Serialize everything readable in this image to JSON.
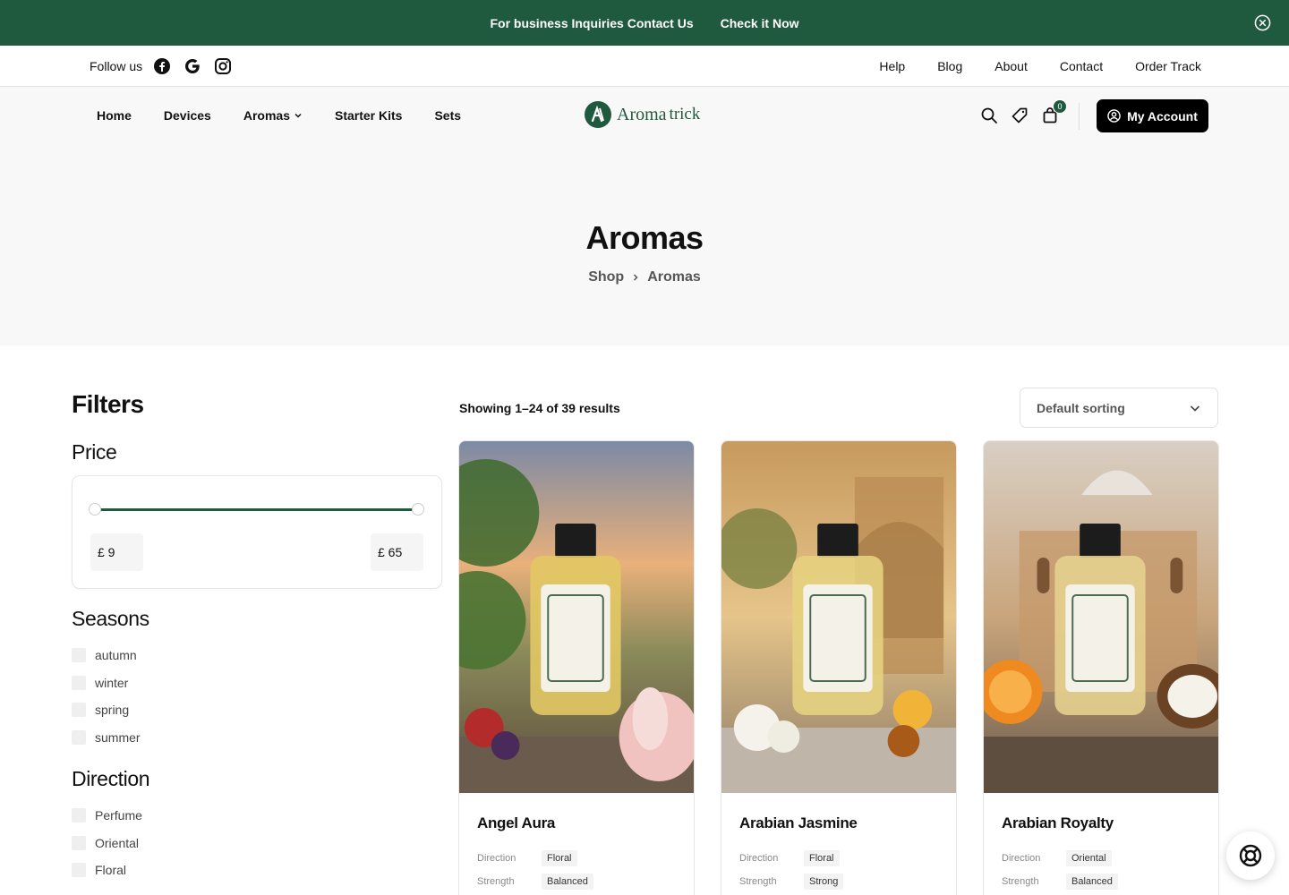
{
  "announcement": {
    "contact_link": "For business Inquiries Contact Us",
    "check_link": "Check it Now"
  },
  "utility_bar": {
    "follow_label": "Follow us",
    "social_icons": [
      "facebook-icon",
      "google-icon",
      "instagram-icon"
    ],
    "links": [
      "Help",
      "Blog",
      "About",
      "Contact",
      "Order Track"
    ]
  },
  "nav": {
    "items": [
      "Home",
      "Devices",
      "Aromas",
      "Starter Kits",
      "Sets"
    ]
  },
  "logo": {
    "word1": "Aroma",
    "word2": "trick"
  },
  "header_actions": {
    "cart_count": "0",
    "account_label": "My Account"
  },
  "hero": {
    "title": "Aromas",
    "breadcrumb": [
      "Shop",
      "Aromas"
    ]
  },
  "filters": {
    "title": "Filters",
    "price": {
      "title": "Price",
      "min": "£ 9",
      "max": "£ 65"
    },
    "seasons": {
      "title": "Seasons",
      "options": [
        "autumn",
        "winter",
        "spring",
        "summer"
      ]
    },
    "direction": {
      "title": "Direction",
      "options": [
        "Perfume",
        "Oriental",
        "Floral"
      ]
    }
  },
  "listing": {
    "results_text": "Showing 1–24 of 39 results",
    "sort_value": "Default sorting",
    "attr_labels": {
      "direction": "Direction",
      "strength": "Strength"
    },
    "products": [
      {
        "name": "Angel Aura",
        "direction": "Floral",
        "strength": "Balanced"
      },
      {
        "name": "Arabian Jasmine",
        "direction": "Floral",
        "strength": "Strong"
      },
      {
        "name": "Arabian Royalty",
        "direction": "Oriental",
        "strength": "Balanced"
      }
    ]
  },
  "colors": {
    "brand_green": "#205a3e",
    "black": "#000000",
    "hero_bg": "#f8f8f8"
  }
}
